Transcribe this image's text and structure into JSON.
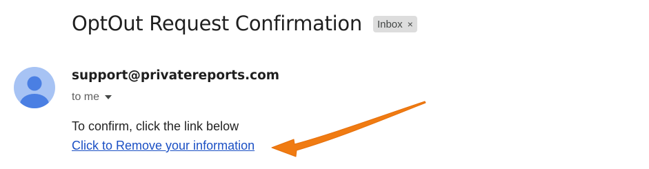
{
  "email": {
    "subject": "OptOut Request Confirmation",
    "label": "Inbox",
    "label_close": "×",
    "sender": "support@privatereports.com",
    "recipient_text": "to me",
    "body_line": "To confirm, click the link below",
    "link_text": "Click to Remove your information"
  },
  "icons": {
    "avatar": "default-person-avatar-icon",
    "recipient_details": "caret-down-icon",
    "annotation": "orange-arrow-annotation"
  },
  "colors": {
    "avatar_background": "#a7c3f4",
    "avatar_figure": "#4a7fe3",
    "link": "#1a4fc4",
    "label_chip": "#dddddd",
    "annotation_arrow": "#f07b12"
  }
}
